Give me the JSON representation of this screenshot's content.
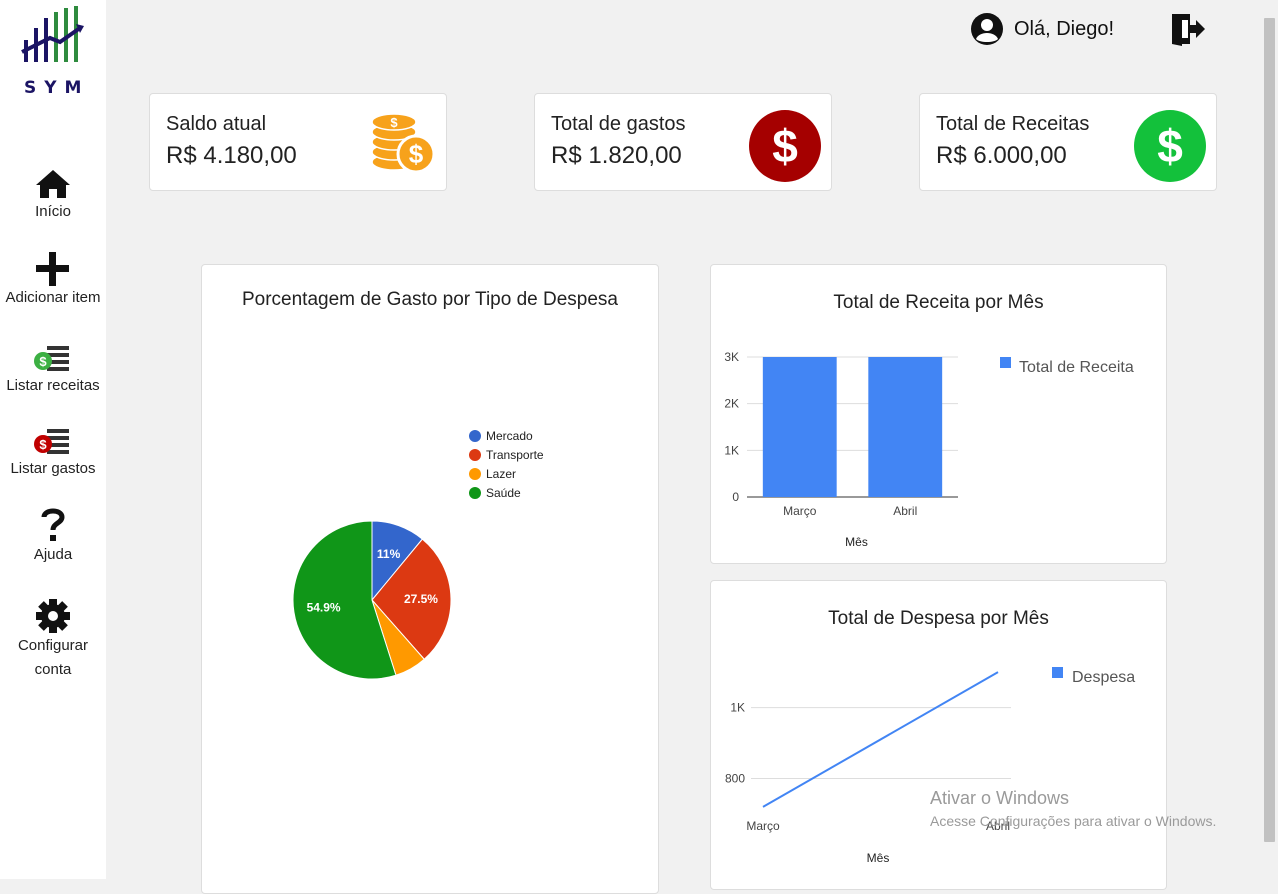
{
  "sidebar": {
    "logo_text": "SYM",
    "items": [
      {
        "label": "Início",
        "icon": "home-icon"
      },
      {
        "label": "Adicionar item",
        "icon": "plus-icon"
      },
      {
        "label": "Listar receitas",
        "icon": "income-list-icon"
      },
      {
        "label": "Listar gastos",
        "icon": "expense-list-icon"
      },
      {
        "label": "Ajuda",
        "icon": "help-icon"
      },
      {
        "label_line1": "Configurar",
        "label_line2": "conta",
        "icon": "gear-icon"
      }
    ]
  },
  "header": {
    "greeting": "Olá, Diego!",
    "user_icon": "user-avatar-icon",
    "logout_icon": "logout-icon"
  },
  "cards": [
    {
      "title": "Saldo atual",
      "value": "R$ 4.180,00",
      "icon": "coins-icon",
      "color": "#f7a21b"
    },
    {
      "title": "Total de gastos",
      "value": "R$ 1.820,00",
      "icon": "dollar-red-icon",
      "color": "#a50000"
    },
    {
      "title": "Total de Receitas",
      "value": "R$ 6.000,00",
      "icon": "dollar-green-icon",
      "color": "#13c13b"
    }
  ],
  "colors": {
    "blue": "#4285f4"
  },
  "chart_data": [
    {
      "type": "pie",
      "title": "Porcentagem de Gasto por Tipo de Despesa",
      "legend_position": "right",
      "slices": [
        {
          "name": "Mercado",
          "value": 11.0,
          "label": "11%",
          "color": "#3366cc"
        },
        {
          "name": "Transporte",
          "value": 27.5,
          "label": "27.5%",
          "color": "#dc3912"
        },
        {
          "name": "Lazer",
          "value": 6.6,
          "label": "",
          "color": "#ff9900"
        },
        {
          "name": "Saúde",
          "value": 54.9,
          "label": "54.9%",
          "color": "#109618"
        }
      ]
    },
    {
      "type": "bar",
      "title": "Total de Receita por Mês",
      "categories": [
        "Março",
        "Abril"
      ],
      "series": [
        {
          "name": "Total de Receita",
          "values": [
            3000,
            3000
          ]
        }
      ],
      "xlabel": "Mês",
      "ylabel": "",
      "ylim": [
        0,
        3000
      ],
      "yticks": [
        {
          "value": 0,
          "label": "0"
        },
        {
          "value": 1000,
          "label": "1K"
        },
        {
          "value": 2000,
          "label": "2K"
        },
        {
          "value": 3000,
          "label": "3K"
        }
      ],
      "grid": true,
      "legend_position": "right"
    },
    {
      "type": "line",
      "title": "Total de Despesa por Mês",
      "categories": [
        "Março",
        "Abril"
      ],
      "series": [
        {
          "name": "Despesa",
          "values": [
            720,
            1100
          ]
        }
      ],
      "xlabel": "Mês",
      "ylabel": "",
      "ylim": [
        700,
        1120
      ],
      "yticks": [
        {
          "value": 800,
          "label": "800"
        },
        {
          "value": 1000,
          "label": "1K"
        }
      ],
      "grid": true,
      "legend_position": "right"
    }
  ],
  "watermark": {
    "line1": "Ativar o Windows",
    "line2": "Acesse Configurações para ativar o Windows."
  }
}
